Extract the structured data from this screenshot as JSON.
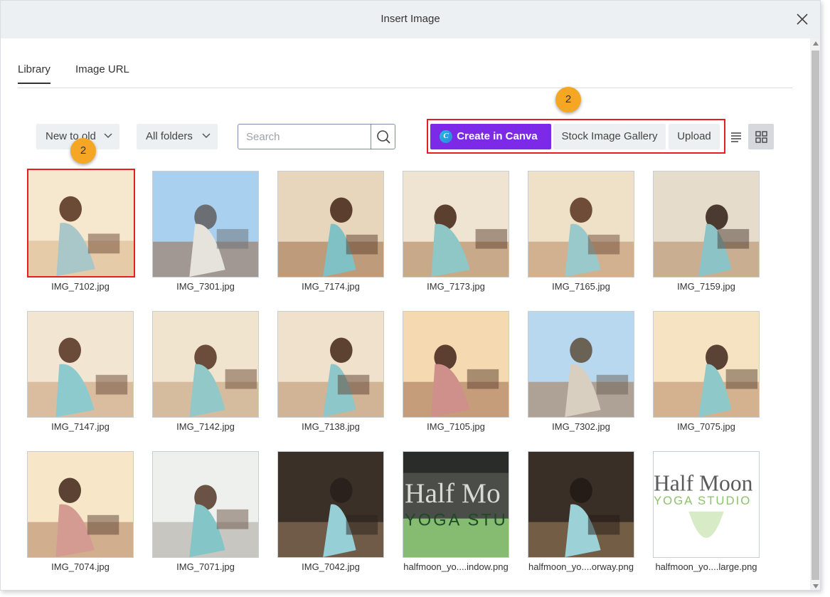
{
  "dialog": {
    "title": "Insert Image",
    "close_icon": "close-icon"
  },
  "tabs": [
    {
      "label": "Library",
      "active": true
    },
    {
      "label": "Image URL",
      "active": false
    }
  ],
  "toolbar": {
    "sort_label": "New to old",
    "folders_label": "All folders",
    "search_placeholder": "Search",
    "search_value": "",
    "canva_label": "Create in Canva",
    "stock_label": "Stock Image Gallery",
    "upload_label": "Upload",
    "view_list_icon": "list-view-icon",
    "view_grid_icon": "grid-view-icon",
    "active_view": "grid"
  },
  "annotations": {
    "badge_top": "2",
    "badge_left": "2"
  },
  "colors": {
    "canva_purple": "#7d2ae8",
    "highlight_red": "#e31e24",
    "badge_orange": "#f5a623",
    "titlebar": "#edf0f2"
  },
  "images": [
    {
      "name": "IMG_7102.jpg",
      "selected": true
    },
    {
      "name": "IMG_7301.jpg",
      "selected": false
    },
    {
      "name": "IMG_7174.jpg",
      "selected": false
    },
    {
      "name": "IMG_7173.jpg",
      "selected": false
    },
    {
      "name": "IMG_7165.jpg",
      "selected": false
    },
    {
      "name": "IMG_7159.jpg",
      "selected": false
    },
    {
      "name": "IMG_7147.jpg",
      "selected": false
    },
    {
      "name": "IMG_7142.jpg",
      "selected": false
    },
    {
      "name": "IMG_7138.jpg",
      "selected": false
    },
    {
      "name": "IMG_7105.jpg",
      "selected": false
    },
    {
      "name": "IMG_7302.jpg",
      "selected": false
    },
    {
      "name": "IMG_7075.jpg",
      "selected": false
    },
    {
      "name": "IMG_7074.jpg",
      "selected": false
    },
    {
      "name": "IMG_7071.jpg",
      "selected": false
    },
    {
      "name": "IMG_7042.jpg",
      "selected": false
    },
    {
      "name": "halfmoon_yo....indow.png",
      "selected": false,
      "overlay_lines": [
        "Half Mo",
        "YOGA STU"
      ]
    },
    {
      "name": "halfmoon_yo....orway.png",
      "selected": false
    },
    {
      "name": "halfmoon_yo....large.png",
      "selected": false,
      "overlay_lines": [
        "Half Moon",
        "YOGA STUDIO"
      ]
    }
  ]
}
